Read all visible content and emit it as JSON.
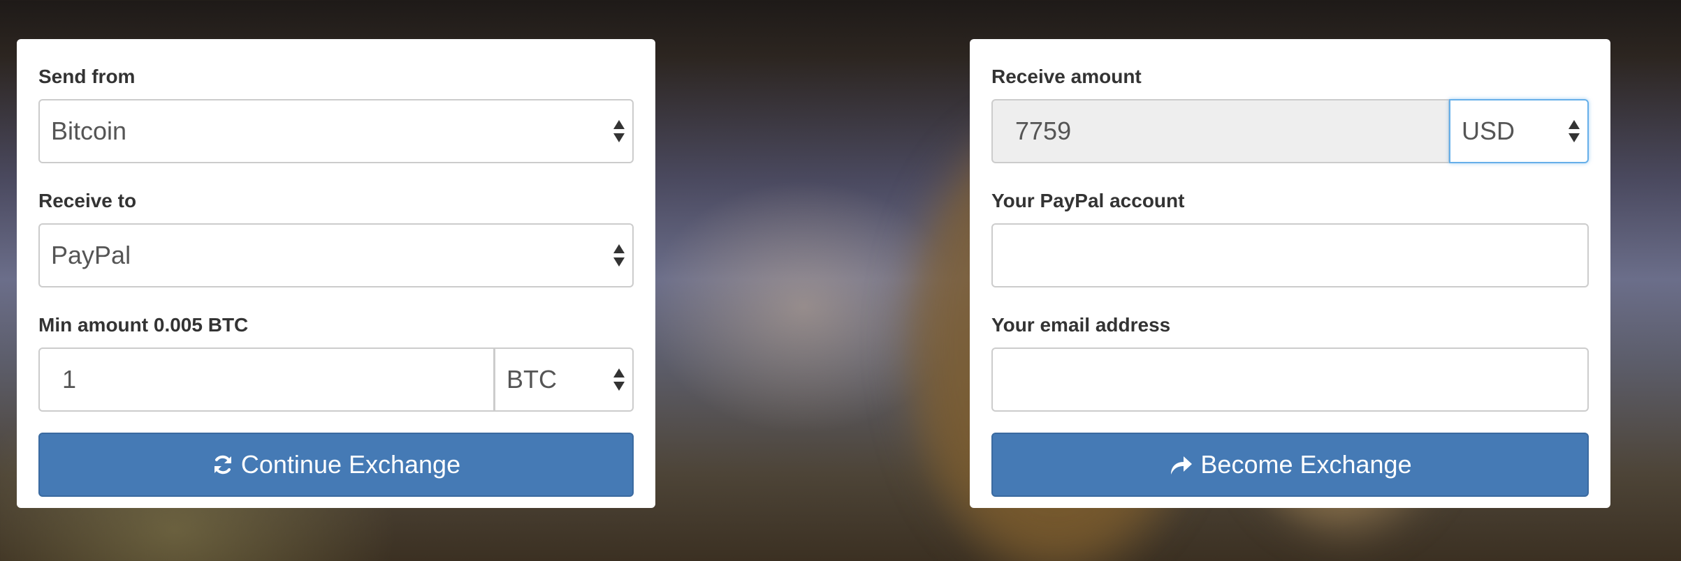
{
  "left_panel": {
    "send_from": {
      "label": "Send from",
      "selected": "Bitcoin"
    },
    "receive_to": {
      "label": "Receive to",
      "selected": "PayPal"
    },
    "amount": {
      "label": "Min amount 0.005 BTC",
      "value": "1",
      "currency": "BTC"
    },
    "continue_button": {
      "label": "Continue Exchange",
      "icon": "refresh-icon"
    }
  },
  "right_panel": {
    "receive_amount": {
      "label": "Receive amount",
      "value": "7759",
      "currency": "USD"
    },
    "paypal_account": {
      "label": "Your PayPal account",
      "value": ""
    },
    "email": {
      "label": "Your email address",
      "value": ""
    },
    "become_button": {
      "label": "Become Exchange",
      "icon": "share-arrow-icon"
    }
  },
  "colors": {
    "button": "#457ab5",
    "focus_border": "#66afe9",
    "readonly_bg": "#eeeeee"
  }
}
